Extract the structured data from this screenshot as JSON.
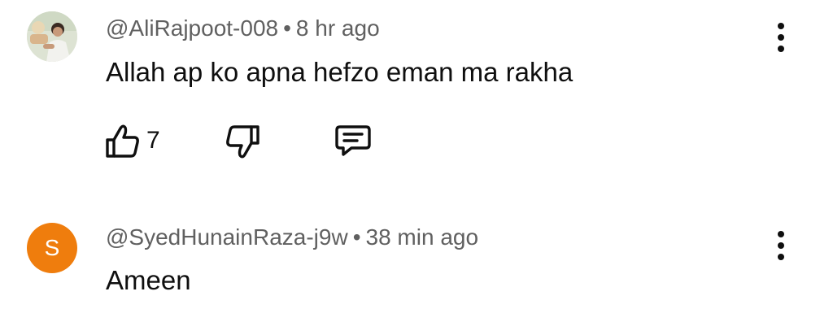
{
  "colors": {
    "meta_text": "#606060",
    "body_text": "#0f0f0f",
    "avatar_s_bg": "#ef7d0d"
  },
  "comments": [
    {
      "author": "@AliRajpoot-008",
      "separator": "•",
      "time": "8 hr ago",
      "text": "Allah ap ko apna hefzo eman ma rakha",
      "likes": "7",
      "avatar": "photo",
      "icons": {
        "like": "thumbs-up-icon",
        "dislike": "thumbs-down-icon",
        "reply": "reply-comment-icon",
        "menu": "more-vertical-icon"
      }
    },
    {
      "author": "@SyedHunainRaza-j9w",
      "separator": "•",
      "time": "38 min ago",
      "text": "Ameen",
      "avatar_letter": "S",
      "icons": {
        "menu": "more-vertical-icon"
      }
    }
  ]
}
